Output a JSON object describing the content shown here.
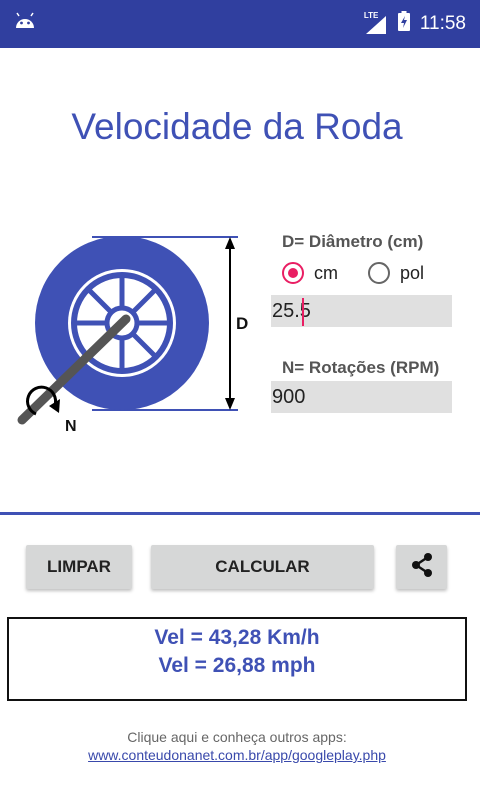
{
  "status_bar": {
    "network": "LTE",
    "time": "11:58"
  },
  "title": "Velocidade da Roda",
  "diagram": {
    "d_letter": "D",
    "n_letter": "N",
    "accent_color": "#3f51b5"
  },
  "diameter": {
    "label": "D= Diâmetro (cm)",
    "options": [
      {
        "label": "cm",
        "selected": true
      },
      {
        "label": "pol",
        "selected": false
      }
    ],
    "value": "25.5"
  },
  "rotations": {
    "label": "N= Rotações (RPM)",
    "value": "900"
  },
  "buttons": {
    "clear": "LIMPAR",
    "calculate": "CALCULAR",
    "share_icon": "share-icon"
  },
  "result": {
    "line1": "Vel = 43,28 Km/h",
    "line2": "Vel = 26,88 mph"
  },
  "footer": {
    "text": "Clique aqui e conheça outros apps:",
    "link": "www.conteudonanet.com.br/app/googleplay.php"
  }
}
